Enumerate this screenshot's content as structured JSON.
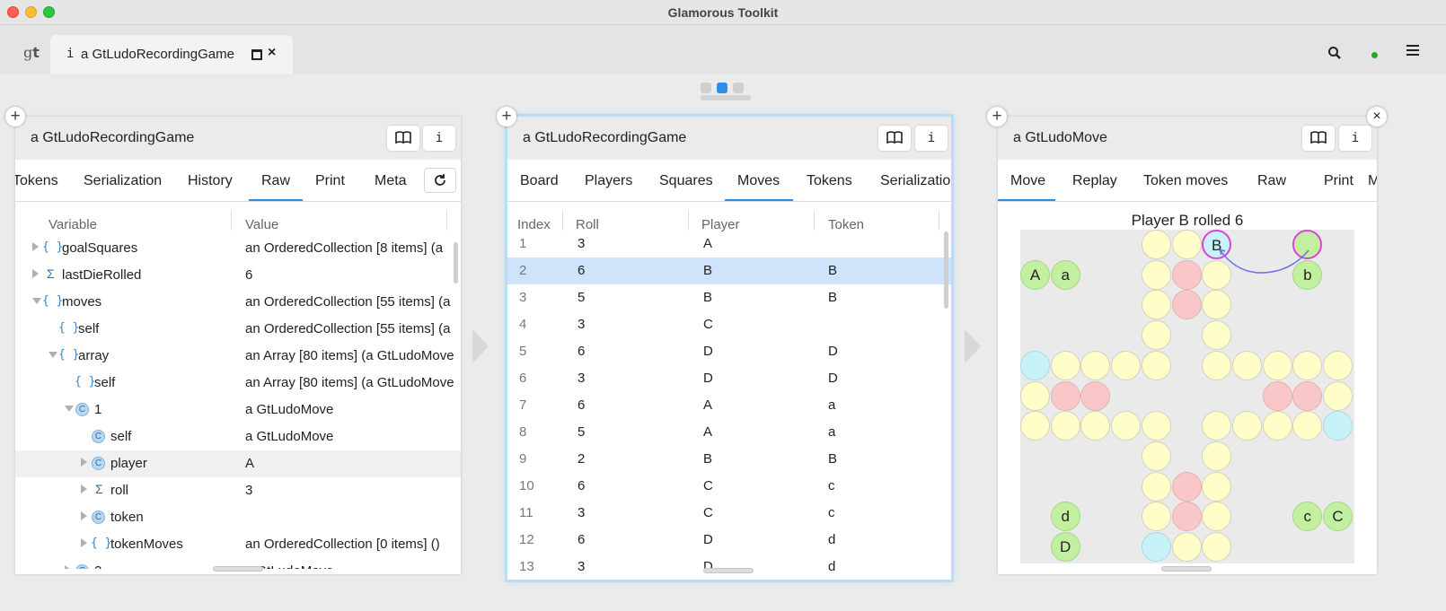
{
  "window": {
    "title": "Glamorous Toolkit"
  },
  "tab": {
    "logo_g": "g",
    "logo_t": "t",
    "icon": "i",
    "label": "a GtLudoRecordingGame"
  },
  "left": {
    "title": "a GtLudoRecordingGame",
    "info": "i",
    "tabs": [
      "Tokens",
      "Serialization",
      "History",
      "Raw",
      "Print",
      "Meta"
    ],
    "active_tab": "Raw",
    "columns": [
      "Variable",
      "Value"
    ],
    "rows": [
      {
        "name": "goalSquares",
        "value": "an OrderedCollection [8 items] (a",
        "icon": "brace",
        "indent": 0,
        "toggle": "r"
      },
      {
        "name": "lastDieRolled",
        "value": "6",
        "icon": "sigma",
        "indent": 0,
        "toggle": "r"
      },
      {
        "name": "moves",
        "value": "an OrderedCollection [55 items] (a",
        "icon": "brace",
        "indent": 0,
        "toggle": "d"
      },
      {
        "name": "self",
        "value": "an OrderedCollection [55 items] (a",
        "icon": "brace",
        "indent": 1,
        "toggle": ""
      },
      {
        "name": "array",
        "value": "an Array [80 items] (a GtLudoMove",
        "icon": "brace",
        "indent": 1,
        "toggle": "d"
      },
      {
        "name": "self",
        "value": "an Array [80 items] (a GtLudoMove",
        "icon": "brace",
        "indent": 2,
        "toggle": ""
      },
      {
        "name": "1",
        "value": "a GtLudoMove",
        "icon": "circle",
        "indent": 2,
        "toggle": "d"
      },
      {
        "name": "self",
        "value": "a GtLudoMove",
        "icon": "circle",
        "indent": 3,
        "toggle": ""
      },
      {
        "name": "player",
        "value": "A",
        "icon": "circle",
        "indent": 3,
        "toggle": "r"
      },
      {
        "name": "roll",
        "value": "3",
        "icon": "sigma",
        "indent": 3,
        "toggle": "r"
      },
      {
        "name": "token",
        "value": "",
        "icon": "circle",
        "indent": 3,
        "toggle": "r"
      },
      {
        "name": "tokenMoves",
        "value": "an OrderedCollection [0 items] ()",
        "icon": "brace",
        "indent": 3,
        "toggle": "r"
      },
      {
        "name": "2",
        "value": "a GtLudoMove",
        "icon": "circle",
        "indent": 2,
        "toggle": "r"
      }
    ],
    "hover_row": 8
  },
  "middle": {
    "title": "a GtLudoRecordingGame",
    "info": "i",
    "tabs": [
      "Board",
      "Players",
      "Squares",
      "Moves",
      "Tokens",
      "Serialization"
    ],
    "active_tab": "Moves",
    "columns": [
      "Index",
      "Roll",
      "Player",
      "Token"
    ],
    "rows": [
      [
        "1",
        "3",
        "A",
        ""
      ],
      [
        "2",
        "6",
        "B",
        "B"
      ],
      [
        "3",
        "5",
        "B",
        "B"
      ],
      [
        "4",
        "3",
        "C",
        ""
      ],
      [
        "5",
        "6",
        "D",
        "D"
      ],
      [
        "6",
        "3",
        "D",
        "D"
      ],
      [
        "7",
        "6",
        "A",
        "a"
      ],
      [
        "8",
        "5",
        "A",
        "a"
      ],
      [
        "9",
        "2",
        "B",
        "B"
      ],
      [
        "10",
        "6",
        "C",
        "c"
      ],
      [
        "11",
        "3",
        "C",
        "c"
      ],
      [
        "12",
        "6",
        "D",
        "d"
      ],
      [
        "13",
        "3",
        "D",
        "d"
      ]
    ],
    "selected_row": 1
  },
  "right": {
    "title": "a GtLudoMove",
    "info": "i",
    "close": "×",
    "tabs": [
      "Move",
      "Replay",
      "Token moves",
      "Raw",
      "Print",
      "M"
    ],
    "active_tab": "Move",
    "board_title": "Player B rolled 6"
  },
  "plus_label": "+",
  "colors": {
    "accent": "#2d8ee6",
    "selection": "#cfe3fb",
    "yellow": "#fffdc8",
    "red": "#f9c7c7",
    "blue": "#c7f3f8",
    "green": "#c3f0a0",
    "highlight": "#e040d8"
  }
}
